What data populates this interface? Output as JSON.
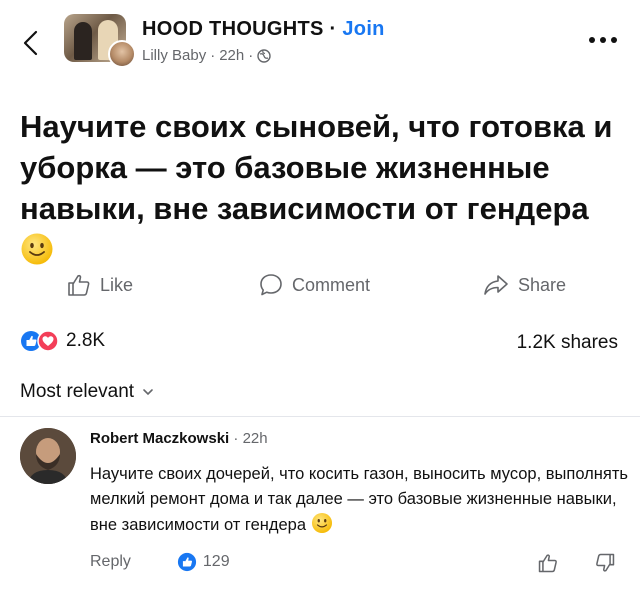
{
  "header": {
    "group_name": "HOOD THOUGHTS",
    "separator": " · ",
    "join_label": "Join",
    "author": "Lilly Baby",
    "time": "22h",
    "meta_sep": "·"
  },
  "post": {
    "text": "Научите своих сыновей, что готовка и уборка — это базовые жизненные навыки, вне зависимости от гендера"
  },
  "actions": {
    "like_label": "Like",
    "comment_label": "Comment",
    "share_label": "Share"
  },
  "stats": {
    "reactions_count": "2.8K",
    "shares_label": "1.2K shares"
  },
  "sort": {
    "label": "Most relevant"
  },
  "comment": {
    "author": "Robert Maczkowski",
    "time_sep": "·",
    "time": "22h",
    "text": "Научите своих дочерей, что косить газон, выносить мусор, выполнять мелкий ремонт дома и так далее — это базовые жизненные навыки, вне зависимости от гендера",
    "reply_label": "Reply",
    "like_count": "129"
  },
  "colors": {
    "accent": "#1877f2",
    "secondary_text": "#65676b",
    "love": "#f33e58",
    "emoji": "#ffcc33"
  }
}
